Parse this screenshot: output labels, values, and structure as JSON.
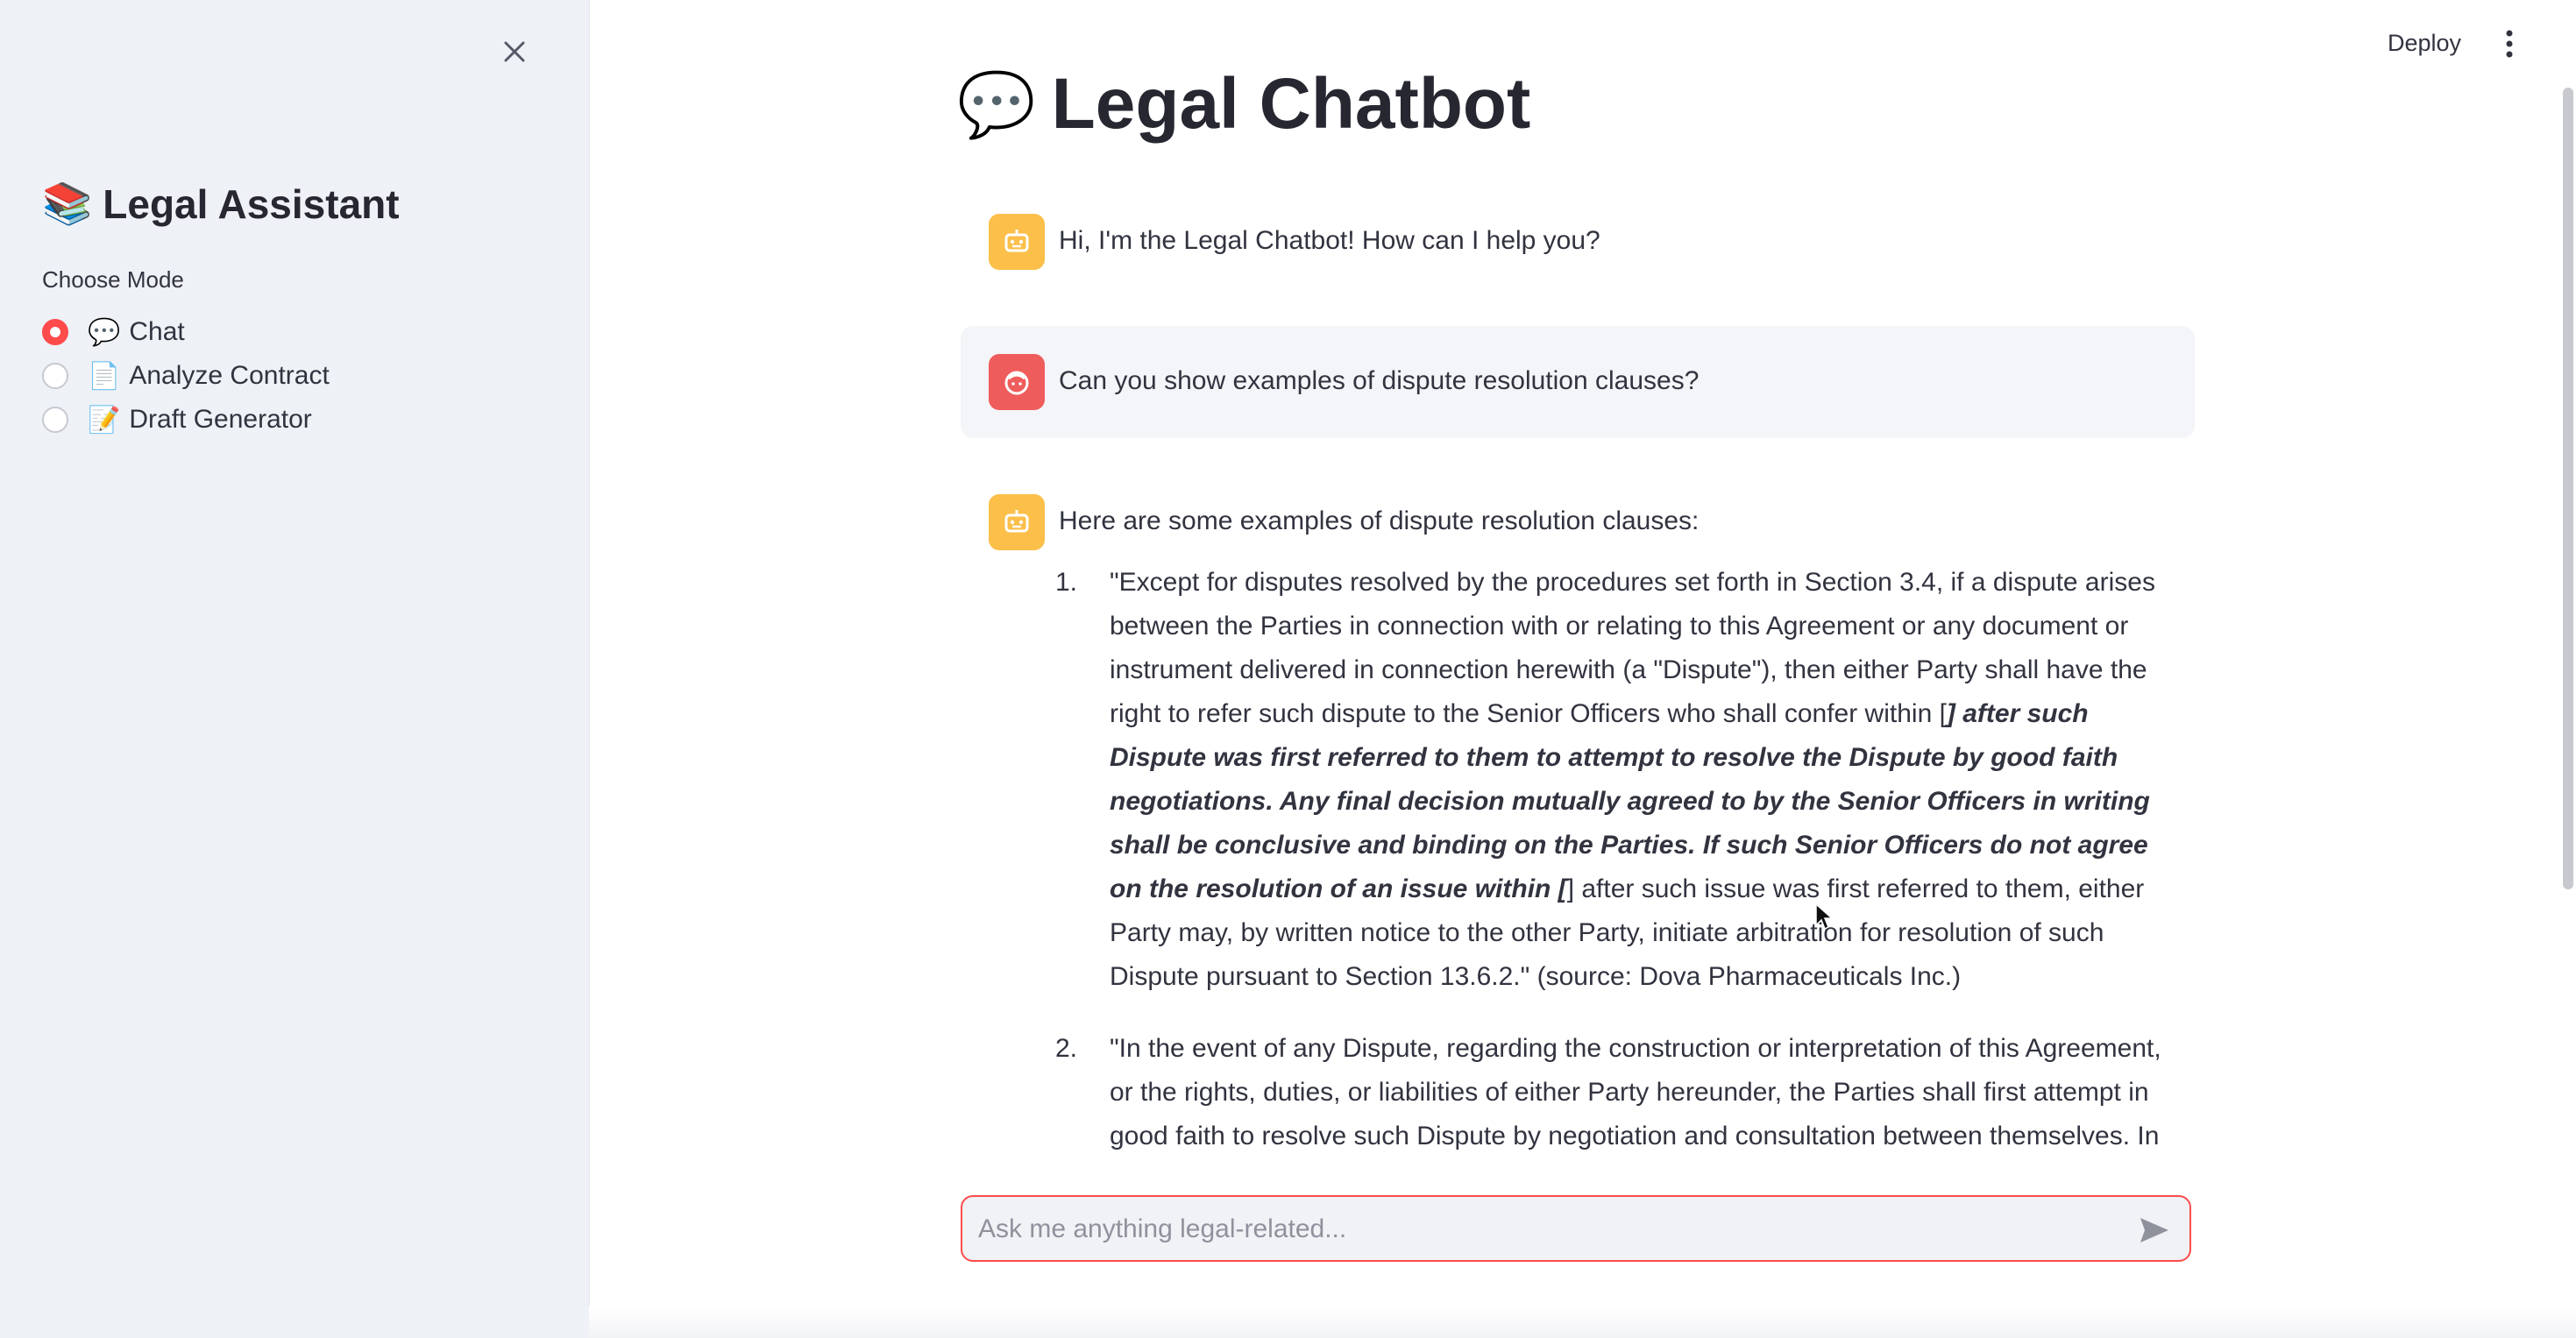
{
  "sidebar": {
    "title_emoji": "📚",
    "title": "Legal Assistant",
    "mode_label": "Choose Mode",
    "modes": [
      {
        "emoji": "💬",
        "label": "Chat",
        "selected": true
      },
      {
        "emoji": "📄",
        "label": "Analyze Contract",
        "selected": false
      },
      {
        "emoji": "📝",
        "label": "Draft Generator",
        "selected": false
      }
    ]
  },
  "header": {
    "deploy_label": "Deploy"
  },
  "main": {
    "title_emoji": "💬",
    "title": "Legal Chatbot",
    "messages": [
      {
        "role": "assistant",
        "text": "Hi, I'm the Legal Chatbot! How can I help you?"
      },
      {
        "role": "user",
        "text": "Can you show examples of dispute resolution clauses?"
      },
      {
        "role": "assistant",
        "text": "Here are some examples of dispute resolution clauses:"
      }
    ],
    "answer_items": [
      {
        "num": "1.",
        "part1": "\"Except for disputes resolved by the procedures set forth in Section 3.4, if a dispute arises between the Parties in connection with or relating to this Agreement or any document or instrument delivered in connection herewith (a \"Dispute\"), then either Party shall have the right to refer such dispute to the Senior Officers who shall confer within [",
        "bold": "] after such Dispute was first referred to them to attempt to resolve the Dispute by good faith negotiations. Any final decision mutually agreed to by the Senior Officers in writing shall be conclusive and binding on the Parties. If such Senior Officers do not agree on the resolution of an issue within [",
        "part2": "] after such issue was first referred to them, either Party may, by written notice to the other Party, initiate arbitration for resolution of such Dispute pursuant to Section 13.6.2.\" (source: Dova Pharmaceuticals Inc.)"
      },
      {
        "num": "2.",
        "text": "\"In the event of any Dispute, regarding the construction or interpretation of this Agreement, or the rights, duties, or liabilities of either Party hereunder, the Parties shall first attempt in good faith to resolve such Dispute by negotiation and consultation between themselves. In"
      }
    ]
  },
  "chat_input": {
    "placeholder": "Ask me anything legal-related...",
    "value": ""
  },
  "colors": {
    "accent": "#ff4b4b",
    "bot_avatar": "#fbbf4a",
    "user_avatar": "#ef5c5c",
    "sidebar_bg": "#eef1f6"
  },
  "icons": {
    "close": "close-icon",
    "menu": "vertical-dots-icon",
    "bot": "robot-icon",
    "user": "user-face-icon",
    "send": "send-icon"
  }
}
